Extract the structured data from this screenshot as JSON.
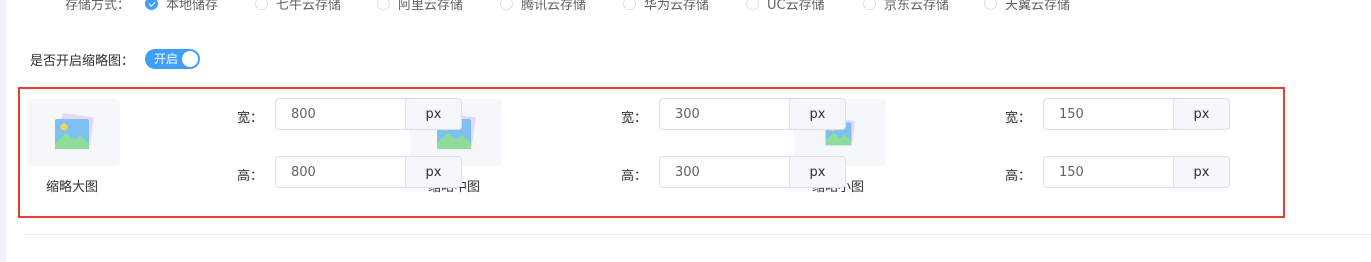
{
  "storage": {
    "label": "存储方式：",
    "options": [
      "本地储存",
      "七牛云存储",
      "阿里云存储",
      "腾讯云存储",
      "华为云存储",
      "UC云存储",
      "京东云存储",
      "天翼云存储"
    ],
    "selected_index": 0
  },
  "thumbnail": {
    "label": "是否开启缩略图：",
    "switch_text": "开启",
    "enabled": true
  },
  "sizes": [
    {
      "card_label": "缩略大图",
      "width_label": "宽：",
      "width_value": "800",
      "height_label": "高：",
      "height_value": "800",
      "unit": "px"
    },
    {
      "card_label": "缩略中图",
      "width_label": "宽：",
      "width_value": "300",
      "height_label": "高：",
      "height_value": "300",
      "unit": "px"
    },
    {
      "card_label": "缩略小图",
      "width_label": "宽：",
      "width_value": "150",
      "height_label": "高：",
      "height_value": "150",
      "unit": "px"
    }
  ],
  "colors": {
    "accent": "#409eff",
    "highlight_border": "#e53e30"
  }
}
